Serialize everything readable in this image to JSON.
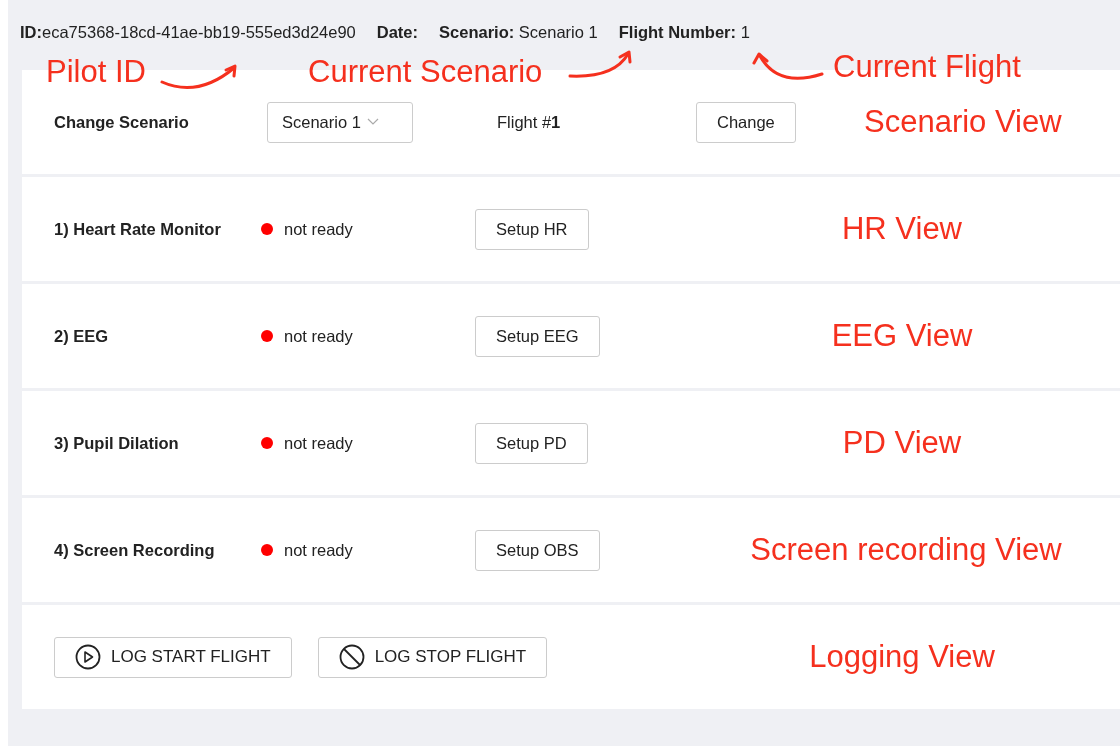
{
  "header": {
    "id_label": "ID:",
    "id_value": "eca75368-18cd-41ae-bb19-555ed3d24e90",
    "date_label": "Date:",
    "scenario_label": "Scenario:",
    "scenario_value": "Scenario 1",
    "flight_label": "Flight Number:",
    "flight_value": "1"
  },
  "callouts": [
    {
      "text": "Pilot ID",
      "kind": "right"
    },
    {
      "text": "Current Scenario",
      "kind": "right"
    },
    {
      "text": "Current Flight",
      "kind": "left"
    }
  ],
  "scenario_view": {
    "label": "Change Scenario",
    "select_value": "Scenario 1",
    "flight": "Flight #**1**",
    "button": "Change",
    "annotation": "Scenario View"
  },
  "sensors": [
    {
      "label": "1) Heart Rate Monitor",
      "ready": false,
      "status": "not ready",
      "button": "Setup HR",
      "annotation": "HR View"
    },
    {
      "label": "2) EEG",
      "ready": false,
      "status": "not ready",
      "button": "Setup EEG",
      "annotation": "EEG View"
    },
    {
      "label": "3) Pupil Dilation",
      "ready": false,
      "status": "not ready",
      "button": "Setup PD",
      "annotation": "PD View"
    },
    {
      "label": "4) Screen Recording",
      "ready": false,
      "status": "not ready",
      "button": "Setup OBS",
      "annotation": "Screen recording View"
    }
  ],
  "logging": {
    "buttons": [
      {
        "label": "LOG START FLIGHT",
        "kind": "start"
      },
      {
        "label": "LOG STOP FLIGHT",
        "kind": "stop"
      }
    ],
    "annotation": "Logging View"
  }
}
